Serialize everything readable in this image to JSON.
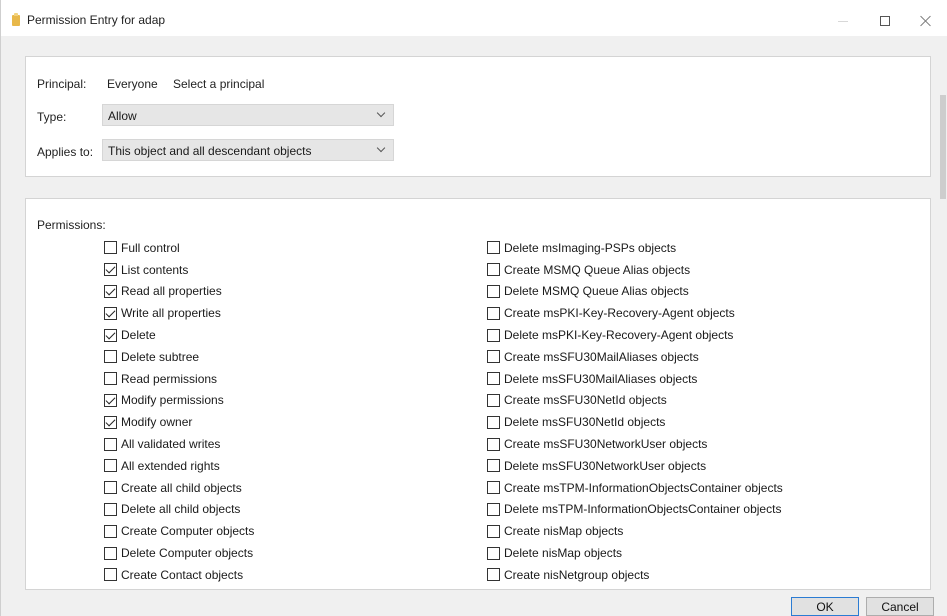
{
  "window": {
    "title": "Permission Entry for adap"
  },
  "principal": {
    "label": "Principal:",
    "value": "Everyone",
    "link": "Select a principal"
  },
  "type": {
    "label": "Type:",
    "value": "Allow"
  },
  "applies_to": {
    "label": "Applies to:",
    "value": "This object and all descendant objects"
  },
  "permissions": {
    "header": "Permissions:",
    "left": [
      {
        "label": "Full control",
        "checked": false
      },
      {
        "label": "List contents",
        "checked": true
      },
      {
        "label": "Read all properties",
        "checked": true
      },
      {
        "label": "Write all properties",
        "checked": true
      },
      {
        "label": "Delete",
        "checked": true
      },
      {
        "label": "Delete subtree",
        "checked": false
      },
      {
        "label": "Read permissions",
        "checked": false
      },
      {
        "label": "Modify permissions",
        "checked": true
      },
      {
        "label": "Modify owner",
        "checked": true
      },
      {
        "label": "All validated writes",
        "checked": false
      },
      {
        "label": "All extended rights",
        "checked": false
      },
      {
        "label": "Create all child objects",
        "checked": false
      },
      {
        "label": "Delete all child objects",
        "checked": false
      },
      {
        "label": "Create Computer objects",
        "checked": false
      },
      {
        "label": "Delete Computer objects",
        "checked": false
      },
      {
        "label": "Create Contact objects",
        "checked": false
      }
    ],
    "right": [
      {
        "label": "Delete msImaging-PSPs objects",
        "checked": false
      },
      {
        "label": "Create MSMQ Queue Alias objects",
        "checked": false
      },
      {
        "label": "Delete MSMQ Queue Alias objects",
        "checked": false
      },
      {
        "label": "Create msPKI-Key-Recovery-Agent objects",
        "checked": false
      },
      {
        "label": "Delete msPKI-Key-Recovery-Agent objects",
        "checked": false
      },
      {
        "label": "Create msSFU30MailAliases objects",
        "checked": false
      },
      {
        "label": "Delete msSFU30MailAliases objects",
        "checked": false
      },
      {
        "label": "Create msSFU30NetId objects",
        "checked": false
      },
      {
        "label": "Delete msSFU30NetId objects",
        "checked": false
      },
      {
        "label": "Create msSFU30NetworkUser objects",
        "checked": false
      },
      {
        "label": "Delete msSFU30NetworkUser objects",
        "checked": false
      },
      {
        "label": "Create msTPM-InformationObjectsContainer objects",
        "checked": false
      },
      {
        "label": "Delete msTPM-InformationObjectsContainer objects",
        "checked": false
      },
      {
        "label": "Create nisMap objects",
        "checked": false
      },
      {
        "label": "Delete nisMap objects",
        "checked": false
      },
      {
        "label": "Create nisNetgroup objects",
        "checked": false
      }
    ]
  },
  "buttons": {
    "ok": "OK",
    "cancel": "Cancel"
  }
}
